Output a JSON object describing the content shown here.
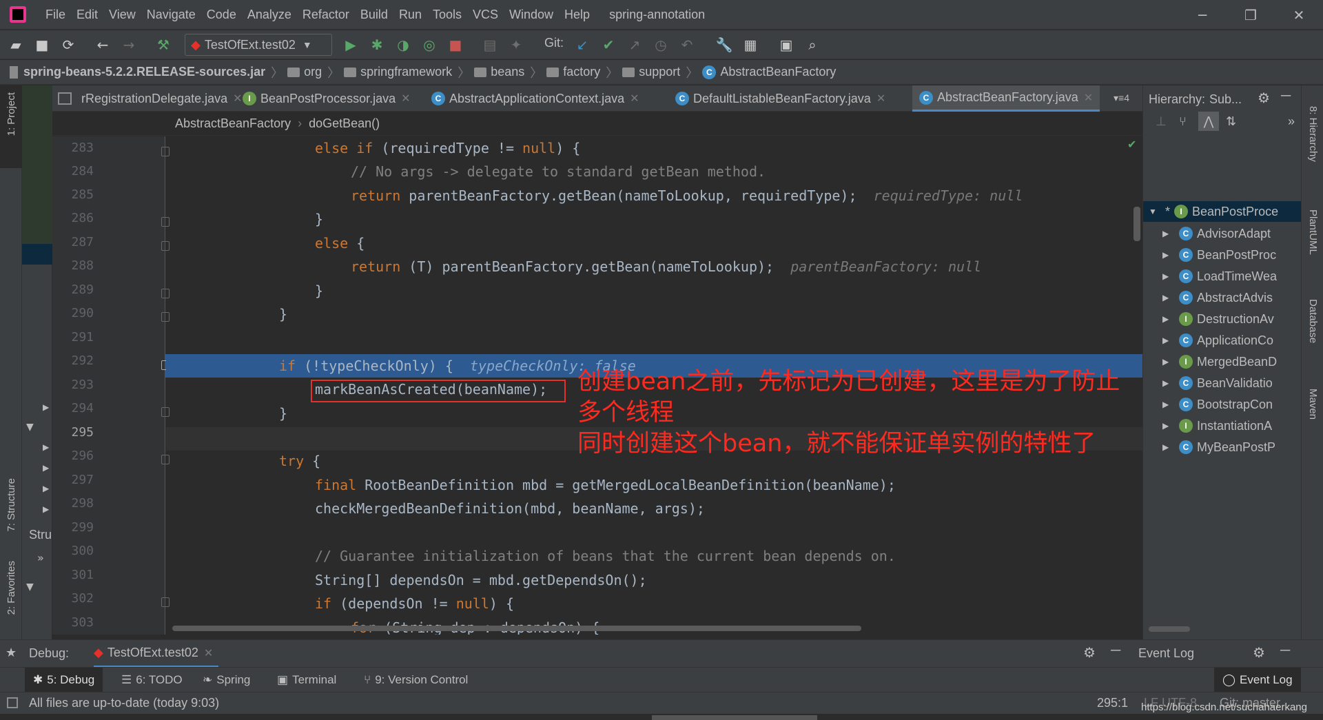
{
  "window": {
    "menu": [
      "File",
      "Edit",
      "View",
      "Navigate",
      "Code",
      "Analyze",
      "Refactor",
      "Build",
      "Run",
      "Tools",
      "VCS",
      "Window",
      "Help"
    ],
    "project_name": "spring-annotation"
  },
  "toolbar": {
    "run_config": "TestOfExt.test02",
    "git_label": "Git:"
  },
  "navbar": {
    "jar": "spring-beans-5.2.2.RELEASE-sources.jar",
    "crumbs": [
      "org",
      "springframework",
      "beans",
      "factory",
      "support"
    ],
    "class": "AbstractBeanFactory"
  },
  "tabs": [
    {
      "label": "rRegistrationDelegate.java",
      "icon": "none"
    },
    {
      "label": "BeanPostProcessor.java",
      "icon": "I"
    },
    {
      "label": "AbstractApplicationContext.java",
      "icon": "C"
    },
    {
      "label": "DefaultListableBeanFactory.java",
      "icon": "C"
    },
    {
      "label": "AbstractBeanFactory.java",
      "icon": "C",
      "active": true
    }
  ],
  "tabs_overflow": "4",
  "editor_breadcrumb": {
    "cls": "AbstractBeanFactory",
    "method": "doGetBean()"
  },
  "code": {
    "lines": [
      "283",
      "284",
      "285",
      "286",
      "287",
      "288",
      "289",
      "290",
      "291",
      "292",
      "293",
      "294",
      "295",
      "296",
      "297",
      "298",
      "299",
      "300",
      "301",
      "302",
      "303"
    ],
    "l283_kw": "else if",
    "l283_rest": " (requiredType != ",
    "l283_null": "null",
    "l283_end": ") {",
    "l284": "// No args -> delegate to standard getBean method.",
    "l285_kw": "return",
    "l285_rest": " parentBeanFactory.getBean(nameToLookup, requiredType);",
    "l285_hint": "requiredType: null",
    "l286": "}",
    "l287_kw": "else",
    "l287_rest": " {",
    "l288_kw": "return",
    "l288_rest": " (T) parentBeanFactory.getBean(nameToLookup);",
    "l288_hint": "parentBeanFactory: null",
    "l289": "}",
    "l290": "}",
    "l292_kw": "if",
    "l292_rest": " (!typeCheckOnly) {",
    "l292_hint": "typeCheckOnly: false",
    "l293": "markBeanAsCreated(beanName);",
    "l294": "}",
    "l296_kw": "try",
    "l296_rest": " {",
    "l297_kw": "final",
    "l297_rest": " RootBeanDefinition mbd = getMergedLocalBeanDefinition(beanName);",
    "l298": "checkMergedBeanDefinition(mbd, beanName, args);",
    "l300": "// Guarantee initialization of beans that the current bean depends on.",
    "l301": "String[] dependsOn = mbd.getDependsOn();",
    "l302_kw": "if",
    "l302_rest": " (dependsOn != ",
    "l302_null": "null",
    "l302_end": ") {",
    "l303_kw": "for",
    "l303_rest": " (String dep : dependsOn) {"
  },
  "annotation": {
    "line1": "创建bean之前，先标记为已创建，这里是为了防止多个线程",
    "line2": "同时创建这个bean，就不能保证单实例的特性了"
  },
  "hierarchy": {
    "title": "Hierarchy:",
    "mode": "Sub...",
    "items": [
      "BeanPostProce",
      "AdvisorAdapt",
      "BeanPostProc",
      "LoadTimeWea",
      "AbstractAdvis",
      "DestructionAv",
      "ApplicationCo",
      "MergedBeanD",
      "BeanValidatio",
      "BootstrapCon",
      "InstantiationA",
      "MyBeanPostP"
    ]
  },
  "left_stripe": {
    "project": "1: Project",
    "structure": "7: Structure",
    "favorites": "2: Favorites",
    "stru": "Stru"
  },
  "right_stripe": {
    "hierarchy": "8: Hierarchy",
    "plantuml": "PlantUML",
    "database": "Database",
    "maven": "Maven"
  },
  "debug": {
    "label": "Debug:",
    "session": "TestOfExt.test02",
    "event_log": "Event Log"
  },
  "toolwindows": [
    "5: Debug",
    "6: TODO",
    "Spring",
    "Terminal",
    "9: Version Control"
  ],
  "event_log_btn": "Event Log",
  "status": {
    "message": "All files are up-to-date (today 9:03)",
    "position": "295:1",
    "encoding": "LF UTF-8",
    "git": "Git: master",
    "watermark": "https://blog.csdn.net/suchahaerkang"
  }
}
